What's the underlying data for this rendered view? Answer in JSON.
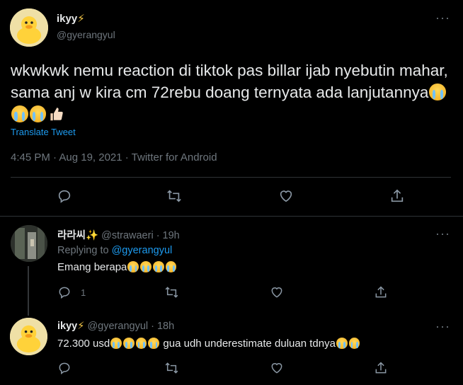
{
  "tweet": {
    "name": "ikyy",
    "name_emoji": "⚡",
    "handle": "@gyerangyul",
    "text": "wkwkwk nemu reaction di tiktok pas billar ijab nyebutin mahar, sama anj w kira cm 72rebu doang ternyata ada lanjutannya",
    "translate": "Translate Tweet",
    "meta": "4:45 PM · Aug 19, 2021 · Twitter for Android",
    "more": "···"
  },
  "reply1": {
    "name": "라라씨",
    "name_emoji": "✨",
    "handle_time": "@strawaeri · 19h",
    "replying_prefix": "Replying to",
    "replying_to": "@gyerangyul",
    "text": "Emang berapa",
    "reply_count": "1",
    "more": "···"
  },
  "reply2": {
    "name": "ikyy",
    "name_emoji": "⚡",
    "handle_time": "@gyerangyul · 18h",
    "text_a": "72.300 usd",
    "text_b": " gua udh underestimate duluan tdnya",
    "more": "···"
  },
  "icons": [
    "reply-icon",
    "retweet-icon",
    "like-icon",
    "share-icon",
    "more-icon"
  ],
  "colors": {
    "background": "#000000",
    "text": "#d9d9d9",
    "muted": "#6e767d",
    "link": "#1d9bf0",
    "divider": "#2f3336"
  }
}
